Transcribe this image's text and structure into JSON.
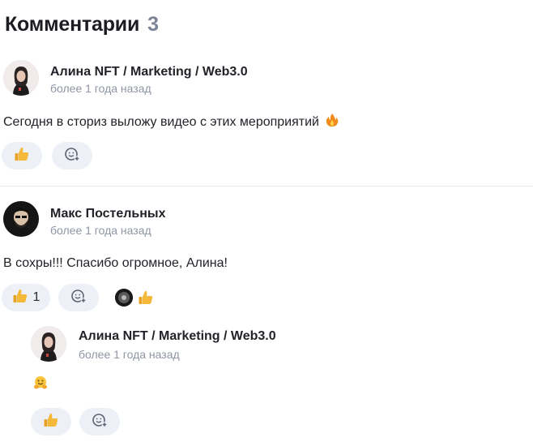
{
  "header": {
    "title": "Комментарии",
    "count": "3"
  },
  "comments": [
    {
      "author": "Алина NFT / Marketing / Web3.0",
      "time": "более 1 года назад",
      "text": "Сегодня в сториз выложу видео с этих мероприятий",
      "text_emoji": "fire-icon",
      "reactions": {
        "like_count": "",
        "add_reaction_icon": "add-reaction-icon"
      }
    },
    {
      "author": "Макс Постельных",
      "time": "более 1 года назад",
      "text": "В сохры!!! Спасибо огромное, Алина!",
      "reactions": {
        "like_count": "1",
        "add_reaction_icon": "add-reaction-icon"
      }
    },
    {
      "author": "Алина NFT / Marketing / Web3.0",
      "time": "более 1 года назад",
      "text_emoji": "hug-icon",
      "reactions": {
        "like_count": "",
        "add_reaction_icon": "add-reaction-icon"
      }
    }
  ],
  "colors": {
    "pill_bg": "#edf1f7",
    "muted": "#8e95a3",
    "count": "#7b8496"
  }
}
